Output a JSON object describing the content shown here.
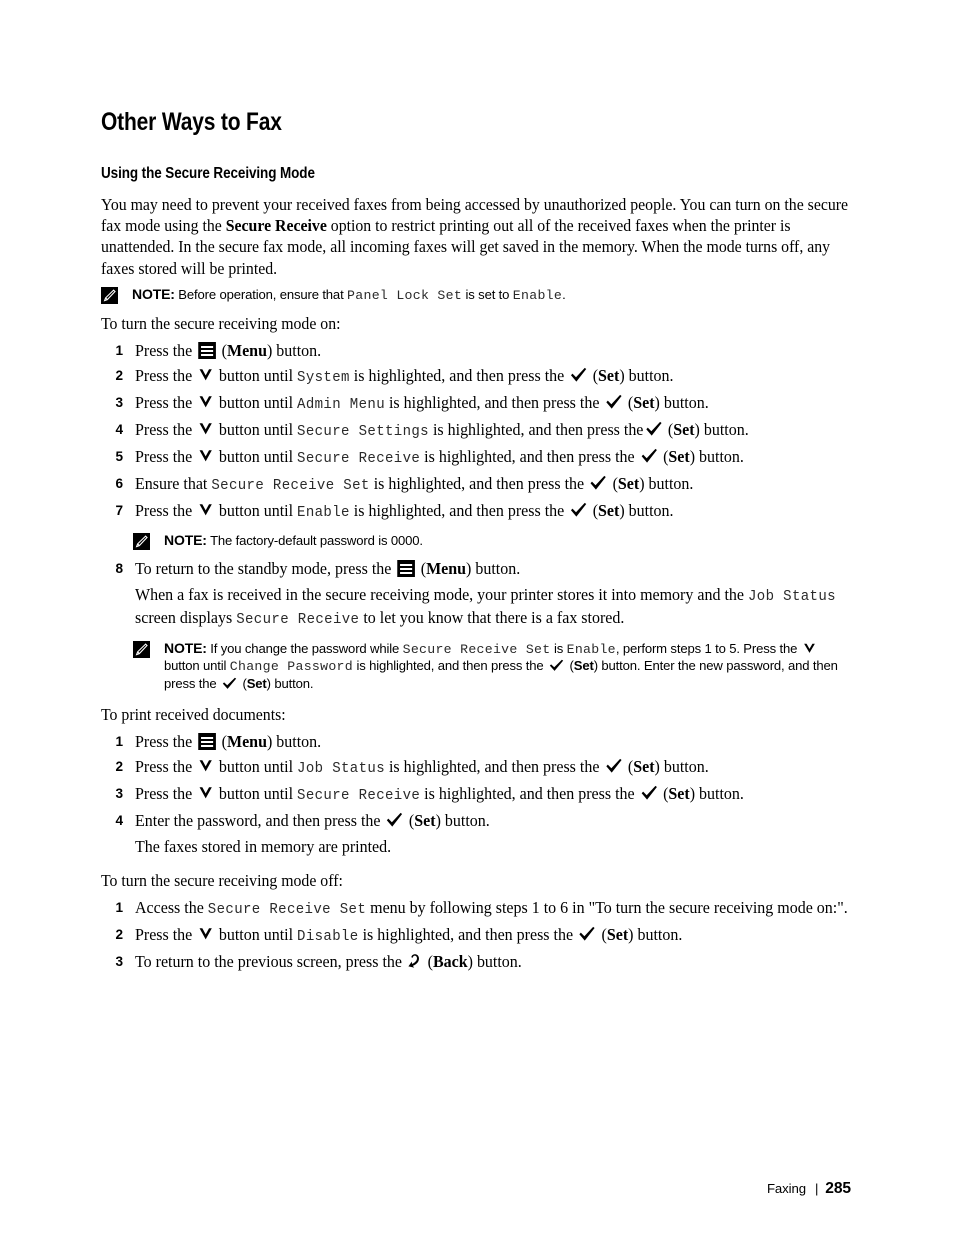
{
  "page": {
    "chapter_title": "Other Ways to Fax",
    "section_title": "Using the Secure Receiving Mode",
    "intro_paragraph_pre": "You may need to prevent your received faxes from being accessed by unauthorized people. You can turn on the secure fax mode using the ",
    "intro_bold": "Secure Receive",
    "intro_paragraph_post": " option to restrict printing out all of the received faxes when the printer is unattended. In the secure fax mode, all incoming faxes will get saved in the memory. When the mode turns off, any faxes stored will be printed."
  },
  "notes": {
    "note_label": "NOTE:",
    "panel_lock": {
      "text_1": " Before operation, ensure that ",
      "mono_1": "Panel Lock Set",
      "text_2": " is set to ",
      "mono_2": "Enable",
      "text_3": "."
    },
    "factory_password": {
      "text_1": " The factory-default password is 0000."
    },
    "change_password": {
      "text_1": " If you change the password while ",
      "mono_1": "Secure Receive Set",
      "text_2": " is ",
      "mono_2": "Enable",
      "text_3": ", perform steps 1 to 5. Press the ",
      "text_4": " button until ",
      "mono_3": "Change Password",
      "text_5": " is highlighted, and then press the ",
      "text_6": " (",
      "set_label": "Set",
      "text_7": ") button. Enter the new password, and then press the ",
      "text_8": " (",
      "text_9": ") button."
    }
  },
  "sections": {
    "turn_on": {
      "lead_in": "To turn the secure receiving mode on:",
      "steps": [
        {
          "num": "1",
          "pre": "Press the ",
          "icon": "menu-icon",
          "mid": " (",
          "button_label": "Menu",
          "post": ") button."
        },
        {
          "num": "2",
          "pre": "Press the ",
          "icon": "down-arrow-icon",
          "mid": " button until ",
          "mono": "System",
          "mid2": " is highlighted, and then press the ",
          "icon2": "check-icon",
          "mid3": " (",
          "button_label": "Set",
          "post": ") button."
        },
        {
          "num": "3",
          "pre": "Press the ",
          "icon": "down-arrow-icon",
          "mid": " button until ",
          "mono": "Admin Menu",
          "mid2": " is highlighted, and then press the ",
          "icon2": "check-icon",
          "mid3": " (",
          "button_label": "Set",
          "post": ") button."
        },
        {
          "num": "4",
          "pre": "Press the ",
          "icon": "down-arrow-icon",
          "mid": " button until ",
          "mono": "Secure Settings",
          "mid2": " is highlighted, and then press the",
          "icon2": "check-icon",
          "mid3": " (",
          "button_label": "Set",
          "post": ") button."
        },
        {
          "num": "5",
          "pre": "Press the ",
          "icon": "down-arrow-icon",
          "mid": " button until ",
          "mono": "Secure Receive",
          "mid2": " is highlighted, and then press the ",
          "icon2": "check-icon",
          "mid3": " (",
          "button_label": "Set",
          "post": ") button."
        },
        {
          "num": "6",
          "pre": "Ensure that ",
          "mono": "Secure Receive Set",
          "mid2": " is highlighted, and then press the ",
          "icon2": "check-icon",
          "mid3": " (",
          "button_label": "Set",
          "post": ") button."
        },
        {
          "num": "7",
          "pre": "Press the ",
          "icon": "down-arrow-icon",
          "mid": " button until ",
          "mono": "Enable",
          "mid2": " is highlighted, and then press the ",
          "icon2": "check-icon",
          "mid3": " (",
          "button_label": "Set",
          "post": ") button."
        },
        {
          "num": "8",
          "pre": "To return to the standby mode, press the ",
          "icon": "menu-icon",
          "mid": " (",
          "button_label": "Menu",
          "post": ") button."
        }
      ],
      "after_step8": {
        "text_1": "When a fax is received in the secure receiving mode, your printer stores it into memory and the ",
        "mono_1": "Job Status",
        "text_2": " screen displays ",
        "mono_2": "Secure Receive",
        "text_3": " to let you know that there is a fax stored."
      }
    },
    "print_received": {
      "lead_in": "To print received documents:",
      "steps": [
        {
          "num": "1",
          "pre": "Press the ",
          "icon": "menu-icon",
          "mid": " (",
          "button_label": "Menu",
          "post": ") button."
        },
        {
          "num": "2",
          "pre": "Press the ",
          "icon": "down-arrow-icon",
          "mid": " button until ",
          "mono": "Job Status",
          "mid2": " is highlighted, and then press the ",
          "icon2": "check-icon",
          "mid3": " (",
          "button_label": "Set",
          "post": ") button."
        },
        {
          "num": "3",
          "pre": "Press the ",
          "icon": "down-arrow-icon",
          "mid": " button until ",
          "mono": "Secure Receive",
          "mid2": " is highlighted, and then press the ",
          "icon2": "check-icon",
          "mid3": " (",
          "button_label": "Set",
          "post": ") button."
        },
        {
          "num": "4",
          "pre": "Enter the password, and then press the ",
          "icon2": "check-icon",
          "mid3": " (",
          "button_label": "Set",
          "post": ") button."
        }
      ],
      "closing": "The faxes stored in memory are printed."
    },
    "turn_off": {
      "lead_in": "To turn the secure receiving mode off:",
      "steps": [
        {
          "num": "1",
          "pre": "Access the ",
          "mono": "Secure Receive Set",
          "mid2": " menu by following steps 1 to 6 in \"To turn the secure receiving mode on:\"."
        },
        {
          "num": "2",
          "pre": "Press the ",
          "icon": "down-arrow-icon",
          "mid": " button until ",
          "mono": "Disable",
          "mid2": " is highlighted, and then press the ",
          "icon2": "check-icon",
          "mid3": " (",
          "button_label": "Set",
          "post": ") button."
        },
        {
          "num": "3",
          "pre": "To return to the previous screen, press the ",
          "icon": "back-arrow-icon",
          "mid": " (",
          "button_label": "Back",
          "post": ") button."
        }
      ]
    }
  },
  "footer": {
    "chapter": "Faxing",
    "separator": "|",
    "page_number": "285"
  }
}
